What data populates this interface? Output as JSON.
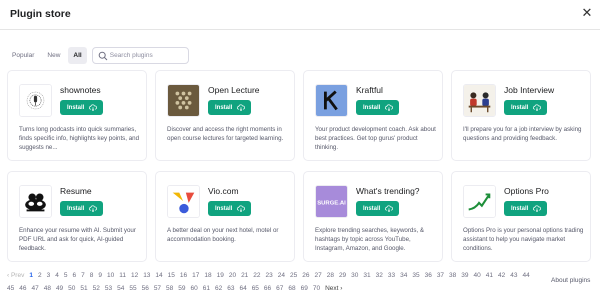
{
  "dialog": {
    "title": "Plugin store",
    "close_icon": "close-icon"
  },
  "filters": {
    "tabs": [
      {
        "label": "Popular",
        "active": false
      },
      {
        "label": "New",
        "active": false
      },
      {
        "label": "All",
        "active": true
      }
    ],
    "search": {
      "placeholder": "Search plugins",
      "value": ""
    }
  },
  "plugins": [
    {
      "name": "shownotes",
      "install_label": "Install",
      "logo": "shownotes-logo",
      "description": "Turns long podcasts into quick summaries, finds specific info, highlights key points, and suggests ne..."
    },
    {
      "name": "Open Lecture",
      "install_label": "Install",
      "logo": "open-lecture-logo",
      "description": "Discover and access the right moments in open course lectures for targeted learning."
    },
    {
      "name": "Kraftful",
      "install_label": "Install",
      "logo": "kraftful-logo",
      "description": "Your product development coach. Ask about best practices. Get top gurus' product thinking."
    },
    {
      "name": "Job Interview",
      "install_label": "Install",
      "logo": "job-interview-logo",
      "description": "I'll prepare you for a job interview by asking questions and providing feedback."
    },
    {
      "name": "Resume",
      "install_label": "Install",
      "logo": "resume-logo",
      "description": "Enhance your resume with AI. Submit your PDF URL and ask for quick, AI-guided feedback."
    },
    {
      "name": "Vio.com",
      "install_label": "Install",
      "logo": "vio-logo",
      "description": "A better deal on your next hotel, motel or accommodation booking."
    },
    {
      "name": "What's trending?",
      "install_label": "Install",
      "logo": "surge-ai-logo",
      "logo_text": "SURGE.AI",
      "description": "Explore trending searches, keywords, & hashtags by topic across YouTube, Instagram, Amazon, and Google."
    },
    {
      "name": "Options Pro",
      "install_label": "Install",
      "logo": "options-pro-logo",
      "description": "Options Pro is your personal options trading assistant to help you navigate market conditions."
    }
  ],
  "pagination": {
    "prev_label": "‹ Prev",
    "next_label": "Next ›",
    "current_page": 1,
    "pages": [
      "1",
      "2",
      "3",
      "4",
      "5",
      "6",
      "7",
      "8",
      "9",
      "10",
      "11",
      "12",
      "13",
      "14",
      "15",
      "16",
      "17",
      "18",
      "19",
      "20",
      "21",
      "22",
      "23",
      "24",
      "25",
      "26",
      "27",
      "28",
      "29",
      "30",
      "31",
      "32",
      "33",
      "34",
      "35",
      "36",
      "37",
      "38",
      "39",
      "40",
      "41",
      "42",
      "43",
      "44",
      "45",
      "46",
      "47",
      "48",
      "49",
      "50",
      "51",
      "52",
      "53",
      "54",
      "55",
      "56",
      "57",
      "58",
      "59",
      "60",
      "61",
      "62",
      "63",
      "64",
      "65",
      "66",
      "67",
      "68",
      "69",
      "70"
    ]
  },
  "footer": {
    "about_label": "About plugins"
  },
  "colors": {
    "install_button": "#10a37f",
    "current_page": "#2563eb"
  }
}
